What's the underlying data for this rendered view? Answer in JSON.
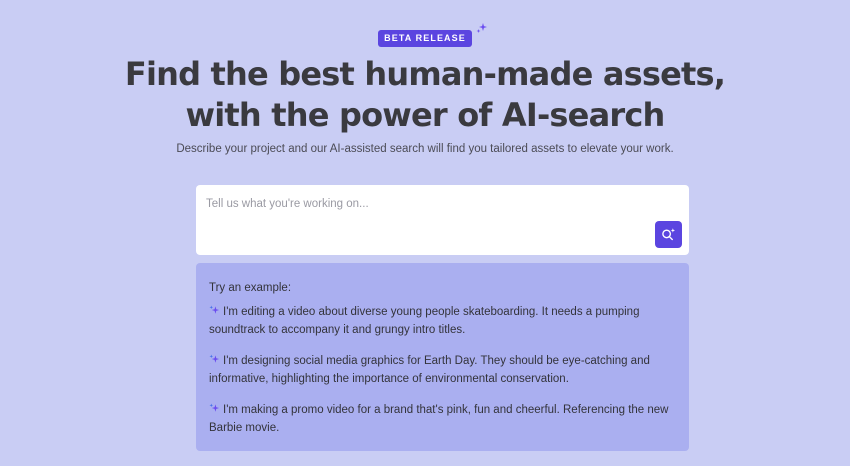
{
  "badge": {
    "label": "BETA RELEASE",
    "sparkle_icon": "sparkle-icon"
  },
  "hero": {
    "headline_line1": "Find the best human-made assets,",
    "headline_line2": "with the power of AI-search",
    "subtitle": "Describe your project and our AI-assisted search will find you tailored assets to elevate your work."
  },
  "search": {
    "placeholder": "Tell us what you're working on...",
    "value": "",
    "button_icon": "ai-search-icon"
  },
  "examples": {
    "title": "Try an example:",
    "items": [
      {
        "text": "I'm editing a video about diverse young people skateboarding. It needs a pumping soundtrack to accompany it and grungy intro titles.",
        "icon": "sparkle-icon"
      },
      {
        "text": "I'm designing social media graphics for Earth Day. They should be eye-catching and informative, highlighting the importance of environmental conservation.",
        "icon": "sparkle-icon"
      },
      {
        "text": "I'm making a promo video for a brand that's pink, fun and cheerful. Referencing the new Barbie movie.",
        "icon": "sparkle-icon"
      }
    ]
  },
  "colors": {
    "background": "#c9cdf4",
    "accent": "#5b45e0",
    "examples_panel": "#aaaff0",
    "headline": "#3a3a3f"
  }
}
